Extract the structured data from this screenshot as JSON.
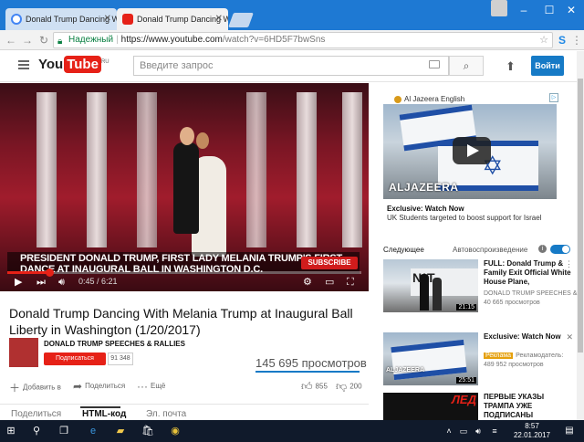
{
  "browser": {
    "tabs": [
      {
        "title": "Donald Trump Dancing W",
        "favicon": "google-icon",
        "active": false
      },
      {
        "title": "Donald Trump Dancing W",
        "favicon": "youtube-icon",
        "active": true
      }
    ],
    "secure_label": "Надежный",
    "url_host": "https://www.youtube.com",
    "url_path": "/watch?v=6HD5F7bwSns"
  },
  "youtube": {
    "logo_you": "You",
    "logo_tube": "Tube",
    "logo_region": "RU",
    "search_placeholder": "Введите запрос",
    "signin_label": "Войти"
  },
  "player": {
    "chyron_line1": "PRESIDENT DONALD TRUMP, FIRST LADY MELANIA TRUMP'S FIRST",
    "chyron_line2": "DANCE AT INAUGURAL BALL IN WASHINGTON D.C.",
    "subscribe_overlay": "SUBSCRIBE",
    "time": "0:45 / 6:21",
    "progress_fraction": 0.118
  },
  "video": {
    "title": "Donald Trump Dancing With Melania Trump at Inaugural Ball Liberty in Washington (1/20/2017)",
    "channel": "DONALD TRUMP SPEECHES & RALLIES",
    "subscribe_label": "Подписаться",
    "subscriber_count": "91 348",
    "views": "145 695 просмотров",
    "add_to": "Добавить в",
    "share": "Поделиться",
    "more": "Ещё",
    "likes": "855",
    "dislikes": "200",
    "bottom_tabs": [
      "Поделиться",
      "HTML-код",
      "Эл. почта"
    ]
  },
  "sidebar": {
    "ad": {
      "advertiser": "Al Jazeera English",
      "logo_text": "ALJAZEERA",
      "title": "Exclusive: Watch Now",
      "subtitle": "UK Students targeted to boost support for Israel"
    },
    "up_next": "Следующее",
    "autoplay": "Автовоспроизведение",
    "videos": [
      {
        "title": "FULL: Donald Trump & Family Exit Official White House Plane,",
        "channel": "DONALD TRUMP SPEECHES &",
        "views": "40 665 просмотров",
        "duration": "21:15"
      },
      {
        "title": "Exclusive: Watch Now",
        "ad_label": "Реклама",
        "advertiser": "Рекламодатель:",
        "views": "489 952 просмотров",
        "duration": "25:51"
      },
      {
        "title": "ПЕРВЫЕ УКАЗЫ ТРАМПА УЖЕ ПОДПИСАНЫ",
        "thumb_text": "ЛЕД"
      }
    ]
  },
  "taskbar": {
    "time": "8:57",
    "date": "22.01.2017"
  },
  "colors": {
    "youtube_red": "#e62117",
    "signin_blue": "#167ac6",
    "titlebar_blue": "#1e79d3",
    "secure_green": "#0b8043"
  }
}
